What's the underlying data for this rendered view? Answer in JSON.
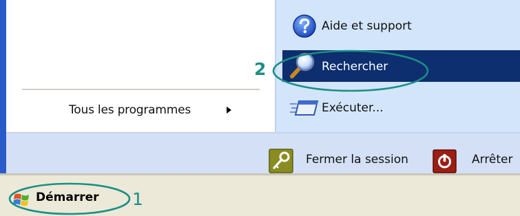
{
  "start_menu": {
    "left_pane": {
      "all_programs_label": "Tous les programmes"
    },
    "right_pane": {
      "items": [
        {
          "label": "Aide et support",
          "icon": "help-icon"
        },
        {
          "label": "Rechercher",
          "icon": "search-icon",
          "highlighted": true
        },
        {
          "label": "Exécuter...",
          "icon": "run-icon"
        }
      ]
    },
    "footer": {
      "logoff_label": "Fermer la session",
      "shutdown_label": "Arrêter"
    }
  },
  "taskbar": {
    "start_label": "Démarrer"
  },
  "annotations": {
    "callout_start": "1",
    "callout_search": "2",
    "ring_color": "#1a8f86"
  },
  "colors": {
    "menu_edge": "#2a5cc9",
    "right_pane_bg": "#d3e5fa",
    "highlight_bg": "#0d2e6f",
    "taskbar_bg": "#ece9d8"
  }
}
